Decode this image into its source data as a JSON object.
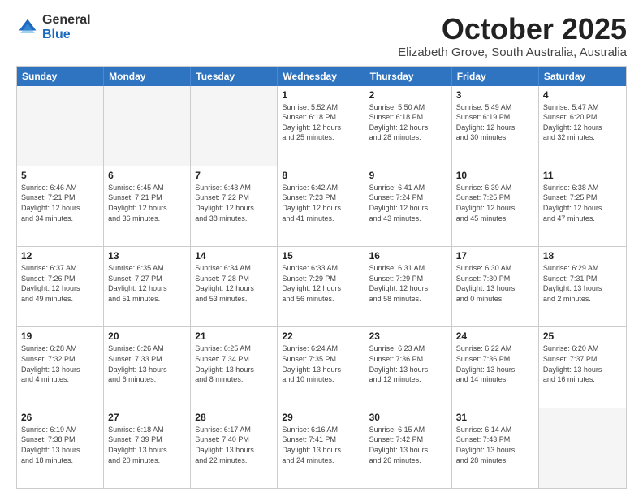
{
  "logo": {
    "general": "General",
    "blue": "Blue"
  },
  "title": "October 2025",
  "subtitle": "Elizabeth Grove, South Australia, Australia",
  "header_days": [
    "Sunday",
    "Monday",
    "Tuesday",
    "Wednesday",
    "Thursday",
    "Friday",
    "Saturday"
  ],
  "weeks": [
    [
      {
        "day": "",
        "info": ""
      },
      {
        "day": "",
        "info": ""
      },
      {
        "day": "",
        "info": ""
      },
      {
        "day": "1",
        "info": "Sunrise: 5:52 AM\nSunset: 6:18 PM\nDaylight: 12 hours\nand 25 minutes."
      },
      {
        "day": "2",
        "info": "Sunrise: 5:50 AM\nSunset: 6:18 PM\nDaylight: 12 hours\nand 28 minutes."
      },
      {
        "day": "3",
        "info": "Sunrise: 5:49 AM\nSunset: 6:19 PM\nDaylight: 12 hours\nand 30 minutes."
      },
      {
        "day": "4",
        "info": "Sunrise: 5:47 AM\nSunset: 6:20 PM\nDaylight: 12 hours\nand 32 minutes."
      }
    ],
    [
      {
        "day": "5",
        "info": "Sunrise: 6:46 AM\nSunset: 7:21 PM\nDaylight: 12 hours\nand 34 minutes."
      },
      {
        "day": "6",
        "info": "Sunrise: 6:45 AM\nSunset: 7:21 PM\nDaylight: 12 hours\nand 36 minutes."
      },
      {
        "day": "7",
        "info": "Sunrise: 6:43 AM\nSunset: 7:22 PM\nDaylight: 12 hours\nand 38 minutes."
      },
      {
        "day": "8",
        "info": "Sunrise: 6:42 AM\nSunset: 7:23 PM\nDaylight: 12 hours\nand 41 minutes."
      },
      {
        "day": "9",
        "info": "Sunrise: 6:41 AM\nSunset: 7:24 PM\nDaylight: 12 hours\nand 43 minutes."
      },
      {
        "day": "10",
        "info": "Sunrise: 6:39 AM\nSunset: 7:25 PM\nDaylight: 12 hours\nand 45 minutes."
      },
      {
        "day": "11",
        "info": "Sunrise: 6:38 AM\nSunset: 7:25 PM\nDaylight: 12 hours\nand 47 minutes."
      }
    ],
    [
      {
        "day": "12",
        "info": "Sunrise: 6:37 AM\nSunset: 7:26 PM\nDaylight: 12 hours\nand 49 minutes."
      },
      {
        "day": "13",
        "info": "Sunrise: 6:35 AM\nSunset: 7:27 PM\nDaylight: 12 hours\nand 51 minutes."
      },
      {
        "day": "14",
        "info": "Sunrise: 6:34 AM\nSunset: 7:28 PM\nDaylight: 12 hours\nand 53 minutes."
      },
      {
        "day": "15",
        "info": "Sunrise: 6:33 AM\nSunset: 7:29 PM\nDaylight: 12 hours\nand 56 minutes."
      },
      {
        "day": "16",
        "info": "Sunrise: 6:31 AM\nSunset: 7:29 PM\nDaylight: 12 hours\nand 58 minutes."
      },
      {
        "day": "17",
        "info": "Sunrise: 6:30 AM\nSunset: 7:30 PM\nDaylight: 13 hours\nand 0 minutes."
      },
      {
        "day": "18",
        "info": "Sunrise: 6:29 AM\nSunset: 7:31 PM\nDaylight: 13 hours\nand 2 minutes."
      }
    ],
    [
      {
        "day": "19",
        "info": "Sunrise: 6:28 AM\nSunset: 7:32 PM\nDaylight: 13 hours\nand 4 minutes."
      },
      {
        "day": "20",
        "info": "Sunrise: 6:26 AM\nSunset: 7:33 PM\nDaylight: 13 hours\nand 6 minutes."
      },
      {
        "day": "21",
        "info": "Sunrise: 6:25 AM\nSunset: 7:34 PM\nDaylight: 13 hours\nand 8 minutes."
      },
      {
        "day": "22",
        "info": "Sunrise: 6:24 AM\nSunset: 7:35 PM\nDaylight: 13 hours\nand 10 minutes."
      },
      {
        "day": "23",
        "info": "Sunrise: 6:23 AM\nSunset: 7:36 PM\nDaylight: 13 hours\nand 12 minutes."
      },
      {
        "day": "24",
        "info": "Sunrise: 6:22 AM\nSunset: 7:36 PM\nDaylight: 13 hours\nand 14 minutes."
      },
      {
        "day": "25",
        "info": "Sunrise: 6:20 AM\nSunset: 7:37 PM\nDaylight: 13 hours\nand 16 minutes."
      }
    ],
    [
      {
        "day": "26",
        "info": "Sunrise: 6:19 AM\nSunset: 7:38 PM\nDaylight: 13 hours\nand 18 minutes."
      },
      {
        "day": "27",
        "info": "Sunrise: 6:18 AM\nSunset: 7:39 PM\nDaylight: 13 hours\nand 20 minutes."
      },
      {
        "day": "28",
        "info": "Sunrise: 6:17 AM\nSunset: 7:40 PM\nDaylight: 13 hours\nand 22 minutes."
      },
      {
        "day": "29",
        "info": "Sunrise: 6:16 AM\nSunset: 7:41 PM\nDaylight: 13 hours\nand 24 minutes."
      },
      {
        "day": "30",
        "info": "Sunrise: 6:15 AM\nSunset: 7:42 PM\nDaylight: 13 hours\nand 26 minutes."
      },
      {
        "day": "31",
        "info": "Sunrise: 6:14 AM\nSunset: 7:43 PM\nDaylight: 13 hours\nand 28 minutes."
      },
      {
        "day": "",
        "info": ""
      }
    ]
  ]
}
